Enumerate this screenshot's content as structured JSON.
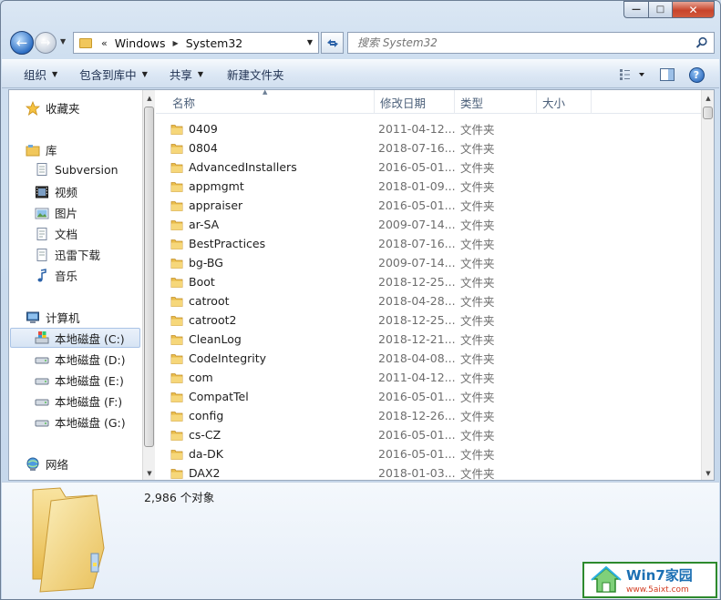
{
  "window": {
    "caption_min": "—",
    "caption_max": "□",
    "caption_close": "✕"
  },
  "nav": {
    "back_glyph": "←",
    "forward_glyph": "→",
    "overflow": "«",
    "breadcrumbs": [
      "Windows",
      "System32"
    ],
    "search_placeholder": "搜索 System32"
  },
  "toolbar": {
    "organize": "组织",
    "include_in_library": "包含到库中",
    "share": "共享",
    "new_folder": "新建文件夹",
    "help": "?"
  },
  "sidebar": {
    "favorites": "收藏夹",
    "libraries": "库",
    "library_items": [
      "Subversion",
      "视频",
      "图片",
      "文档",
      "迅雷下载",
      "音乐"
    ],
    "computer": "计算机",
    "drives": [
      "本地磁盘 (C:)",
      "本地磁盘 (D:)",
      "本地磁盘 (E:)",
      "本地磁盘 (F:)",
      "本地磁盘 (G:)"
    ],
    "network": "网络"
  },
  "columns": {
    "name": "名称",
    "date": "修改日期",
    "type": "类型",
    "size": "大小"
  },
  "files": [
    {
      "name": "0409",
      "date": "2011-04-12...",
      "type": "文件夹"
    },
    {
      "name": "0804",
      "date": "2018-07-16...",
      "type": "文件夹"
    },
    {
      "name": "AdvancedInstallers",
      "date": "2016-05-01...",
      "type": "文件夹"
    },
    {
      "name": "appmgmt",
      "date": "2018-01-09...",
      "type": "文件夹"
    },
    {
      "name": "appraiser",
      "date": "2016-05-01...",
      "type": "文件夹"
    },
    {
      "name": "ar-SA",
      "date": "2009-07-14...",
      "type": "文件夹"
    },
    {
      "name": "BestPractices",
      "date": "2018-07-16...",
      "type": "文件夹"
    },
    {
      "name": "bg-BG",
      "date": "2009-07-14...",
      "type": "文件夹"
    },
    {
      "name": "Boot",
      "date": "2018-12-25...",
      "type": "文件夹"
    },
    {
      "name": "catroot",
      "date": "2018-04-28...",
      "type": "文件夹"
    },
    {
      "name": "catroot2",
      "date": "2018-12-25...",
      "type": "文件夹"
    },
    {
      "name": "CleanLog",
      "date": "2018-12-21...",
      "type": "文件夹"
    },
    {
      "name": "CodeIntegrity",
      "date": "2018-04-08...",
      "type": "文件夹"
    },
    {
      "name": "com",
      "date": "2011-04-12...",
      "type": "文件夹"
    },
    {
      "name": "CompatTel",
      "date": "2016-05-01...",
      "type": "文件夹"
    },
    {
      "name": "config",
      "date": "2018-12-26...",
      "type": "文件夹"
    },
    {
      "name": "cs-CZ",
      "date": "2016-05-01...",
      "type": "文件夹"
    },
    {
      "name": "da-DK",
      "date": "2016-05-01...",
      "type": "文件夹"
    },
    {
      "name": "DAX2",
      "date": "2018-01-03...",
      "type": "文件夹"
    }
  ],
  "details": {
    "count": "2,986 个对象"
  },
  "watermark": {
    "title": "Win7家园",
    "url": "www.5aixt.com"
  }
}
